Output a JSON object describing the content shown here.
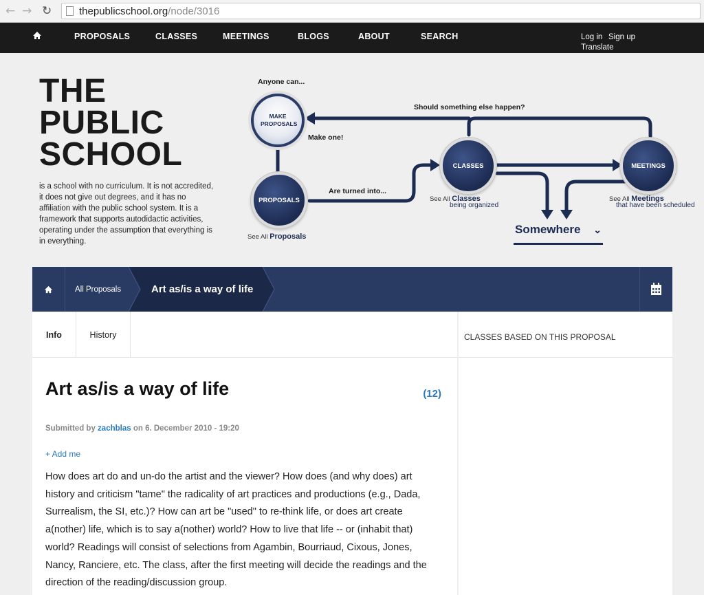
{
  "browser": {
    "url_domain": "thepublicschool.org",
    "url_path": "/node/3016"
  },
  "nav": {
    "items": [
      "PROPOSALS",
      "CLASSES",
      "MEETINGS",
      "BLOGS",
      "ABOUT",
      "SEARCH"
    ],
    "login": "Log in",
    "signup": "Sign up",
    "translate": "Translate"
  },
  "header": {
    "logo_lines": [
      "THE",
      "PUBLIC",
      "SCHOOL"
    ],
    "description": "is a school with no curriculum. It is not accredited, it does not give out degrees, and it has no affiliation with the public school system. It is a framework that supports autodidactic activities, operating under the assumption that everything is in everything."
  },
  "diagram": {
    "anyone_can": "Anyone can...",
    "make_proposals": "MAKE PROPOSALS",
    "make_one": "Make one!",
    "should_something": "Should something else happen?",
    "proposals": "PROPOSALS",
    "turned_into": "Are turned into...",
    "classes": "CLASSES",
    "meetings": "MEETINGS",
    "see_all": "See All",
    "proposals_link": "Proposals",
    "classes_link": "Classes",
    "classes_sub": "being organized",
    "meetings_link": "Meetings",
    "meetings_sub": "that have been scheduled",
    "somewhere": "Somewhere",
    "somewhere_chevron": "⌄"
  },
  "breadcrumb": {
    "all_proposals": "All Proposals",
    "current": "Art as/is a way of life"
  },
  "tabs": [
    "Info",
    "History"
  ],
  "article": {
    "title": "Art as/is a way of life",
    "count": "(12)",
    "submitted_prefix": "Submitted by",
    "author": "zachblas",
    "submitted_suffix": "on 6. December 2010 - 19:20",
    "add_me": "+ Add me",
    "body": "How does art do and un-do the artist and the viewer? How does (and why does) art history and criticism \"tame\" the radicality of art practices and productions (e.g., Dada, Surrealism, the SI, etc.)? How can art be \"used\" to re-think life, or does art create a(nother) life, which is to say a(nother) world? How to live that life -- or (inhabit that) world? Readings will consist of selections from Agambin, Bourriaud, Cixous, Jones, Nancy, Ranciere, etc. The class, after the first meeting will decide the readings and the direction of the reading/discussion group."
  },
  "sidebar": {
    "heading": "CLASSES BASED ON THIS PROPOSAL"
  },
  "colors": {
    "navy": "#2a3b63",
    "link_blue": "#2a7ac0"
  }
}
